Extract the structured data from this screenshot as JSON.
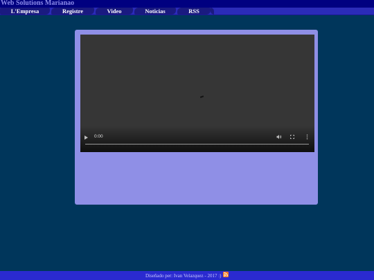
{
  "header": {
    "site_title": "Web Solutions Marianao"
  },
  "nav": {
    "items": [
      {
        "label": "L'Empresa"
      },
      {
        "label": "Registre"
      },
      {
        "label": "Video"
      },
      {
        "label": "Noticias"
      },
      {
        "label": "RSS"
      }
    ]
  },
  "video": {
    "current_time": "0:00",
    "progress": 0,
    "icons": [
      "play-icon",
      "volume-icon",
      "fullscreen-icon",
      "more-options-icon"
    ]
  },
  "footer": {
    "credit": "Diseñado per: Ivan Velazquez - 2017 :)",
    "icon": "rss-icon"
  },
  "colors": {
    "page_background": "#00365b",
    "header_background": "#000080",
    "navbar_background": "#2b2bb8",
    "nav_tab": "#1a1a80",
    "content_panel": "#8f8fe6",
    "footer_background": "#2a2ad0",
    "rss_orange": "#f07a1e"
  }
}
